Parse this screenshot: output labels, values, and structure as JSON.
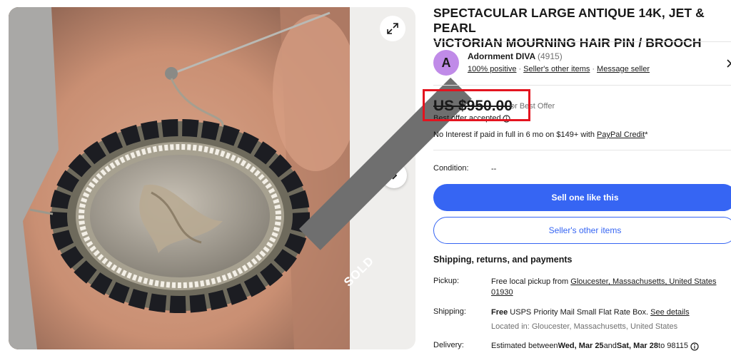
{
  "listing": {
    "title_line1": "SPECTACULAR LARGE ANTIQUE 14K, JET & PEARL",
    "title_line2": "VICTORIAN MOURNING HAIR PIN / BROOCH",
    "status_ribbon": "SOLD"
  },
  "gallery": {
    "expand_icon": "expand-icon",
    "next_icon": "chevron-right-icon"
  },
  "seller": {
    "avatar_letter": "A",
    "avatar_color": "#c08be8",
    "name": "Adornment DIVA",
    "feedback_count": "(4915)",
    "positive": "100% positive",
    "other_items": "Seller's other items",
    "message": "Message seller"
  },
  "price": {
    "amount": "US $950.00",
    "best_offer": "or Best Offer",
    "offer_accepted": "Best offer accepted"
  },
  "financing": {
    "text": "No Interest if paid in full in 6 mo on $149+ with ",
    "link": "PayPal Credit",
    "suffix": "*"
  },
  "condition": {
    "label": "Condition:",
    "value": "--"
  },
  "buttons": {
    "sell_one": "Sell one like this",
    "seller_items": "Seller's other items",
    "primary_color": "#3665f3"
  },
  "shipping": {
    "section_title": "Shipping, returns, and payments",
    "pickup_label": "Pickup:",
    "pickup_prefix": "Free local pickup from ",
    "pickup_location_line1": "Gloucester, Massachusetts, United States",
    "pickup_location_line2": "01930",
    "shipping_label": "Shipping:",
    "shipping_free": "Free",
    "shipping_service": " USPS Priority Mail Small Flat Rate Box. ",
    "see_details": "See details",
    "located_in": "Located in: Gloucester, Massachusetts, United States",
    "delivery_label": "Delivery:",
    "delivery_prefix": "Estimated between ",
    "delivery_start": "Wed, Mar 25",
    "delivery_and": " and ",
    "delivery_end": "Sat, Mar 28",
    "delivery_to": " to 98115"
  },
  "highlight_color": "#e3141f"
}
